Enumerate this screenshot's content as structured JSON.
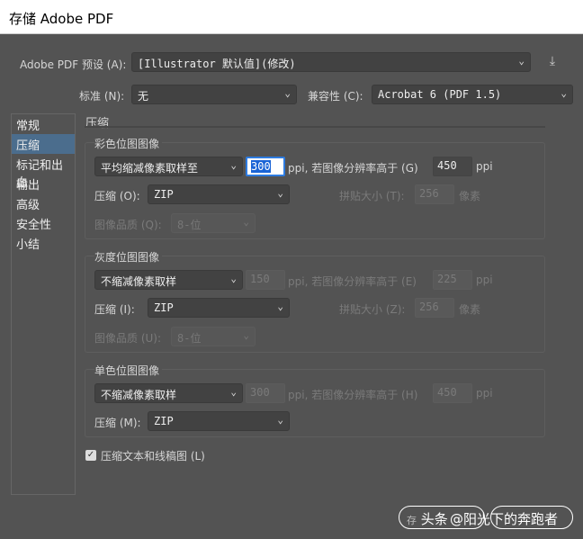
{
  "title": "存储 Adobe PDF",
  "preset": {
    "label": "Adobe PDF 预设 (A):",
    "value": "[Illustrator 默认值](修改)"
  },
  "standard": {
    "label": "标准 (N):",
    "value": "无"
  },
  "compat": {
    "label": "兼容性 (C):",
    "value": "Acrobat 6 (PDF 1.5)"
  },
  "sidebar": {
    "items": [
      {
        "label": "常规"
      },
      {
        "label": "压缩"
      },
      {
        "label": "标记和出血"
      },
      {
        "label": "输出"
      },
      {
        "label": "高级"
      },
      {
        "label": "安全性"
      },
      {
        "label": "小结"
      }
    ],
    "active": "压缩"
  },
  "section_title": "压缩",
  "color": {
    "title": "彩色位图图像",
    "sampling": "平均缩减像素取样至",
    "ppi": "300",
    "ppi_unit": "ppi",
    "above_label": "ppi, 若图像分辨率高于 (G)",
    "above": "450",
    "compress_label": "压缩 (O):",
    "compress": "ZIP",
    "tile_label": "拼贴大小 (T):",
    "tile": "256",
    "tile_unit": "像素",
    "quality_label": "图像品质 (Q):",
    "quality": "8-位"
  },
  "gray": {
    "title": "灰度位图图像",
    "sampling": "不缩减像素取样",
    "ppi": "150",
    "ppi_unit": "ppi",
    "above_label": "ppi, 若图像分辨率高于 (E)",
    "above": "225",
    "compress_label": "压缩 (I):",
    "compress": "ZIP",
    "tile_label": "拼贴大小 (Z):",
    "tile": "256",
    "tile_unit": "像素",
    "quality_label": "图像品质 (U):",
    "quality": "8-位"
  },
  "mono": {
    "title": "单色位图图像",
    "sampling": "不缩减像素取样",
    "ppi": "300",
    "ppi_unit": "ppi",
    "above_label": "ppi, 若图像分辨率高于 (H)",
    "above": "450",
    "compress_label": "压缩 (M):",
    "compress": "ZIP"
  },
  "compress_text": {
    "label": "压缩文本和线稿图 (L)",
    "checked": true
  },
  "footer": {
    "save_partial": "存",
    "watermark1": "头条",
    "watermark2": "@阳光下的奔跑者"
  }
}
